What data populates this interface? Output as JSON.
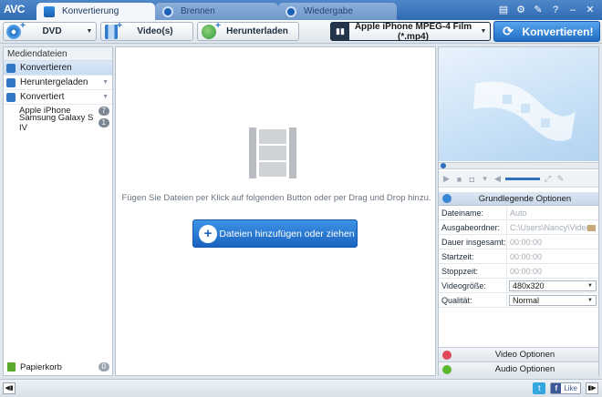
{
  "app": {
    "logo": "AVC"
  },
  "tabs": [
    {
      "label": "Konvertierung",
      "active": true
    },
    {
      "label": "Brennen",
      "active": false
    },
    {
      "label": "Wiedergabe",
      "active": false
    }
  ],
  "window_controls": [
    "menu-icon",
    "gear-icon",
    "wrench-icon",
    "help-icon",
    "minimize-icon",
    "close-icon"
  ],
  "toolbar": {
    "dvd_label": "DVD",
    "videos_label": "Video(s)",
    "download_label": "Herunterladen",
    "profile_label": "Apple iPhone MPEG-4 Film (*.mp4)",
    "convert_label": "Konvertieren!"
  },
  "sidebar": {
    "header": "Mediendateien",
    "categories": [
      {
        "label": "Konvertieren",
        "selected": true
      },
      {
        "label": "Heruntergeladen",
        "selected": false
      },
      {
        "label": "Konvertiert",
        "selected": false
      }
    ],
    "devices": [
      {
        "label": "Apple iPhone",
        "count": "7"
      },
      {
        "label": "Samsung Galaxy S IV",
        "count": "1"
      }
    ],
    "trash": {
      "label": "Papierkorb",
      "count": "0"
    }
  },
  "main": {
    "hint": "Fügen Sie Dateien per Klick auf folgenden Button oder per Drag und Drop hinzu.",
    "add_button": "Dateien hinzufügen oder ziehen"
  },
  "options": {
    "basic_header": "Grundlegende Optionen",
    "fields": [
      {
        "key": "Dateiname:",
        "value": "Auto"
      },
      {
        "key": "Ausgabeordner:",
        "value": "C:\\Users\\Nancy\\Videos..."
      },
      {
        "key": "Dauer insgesamt:",
        "value": "00:00:00"
      },
      {
        "key": "Startzeit:",
        "value": "00:00:00"
      },
      {
        "key": "Stoppzeit:",
        "value": "00:00:00"
      },
      {
        "key": "Videogröße:",
        "value": "480x320"
      },
      {
        "key": "Qualität:",
        "value": "Normal"
      }
    ],
    "video_options": "Video Optionen",
    "audio_options": "Audio Optionen"
  },
  "statusbar": {
    "like_label": "Like"
  },
  "colors": {
    "accent": "#1f6cc6",
    "titlebar": "#2f6bb4",
    "video_opt": "#e0465a",
    "audio_opt": "#5cb82e"
  }
}
